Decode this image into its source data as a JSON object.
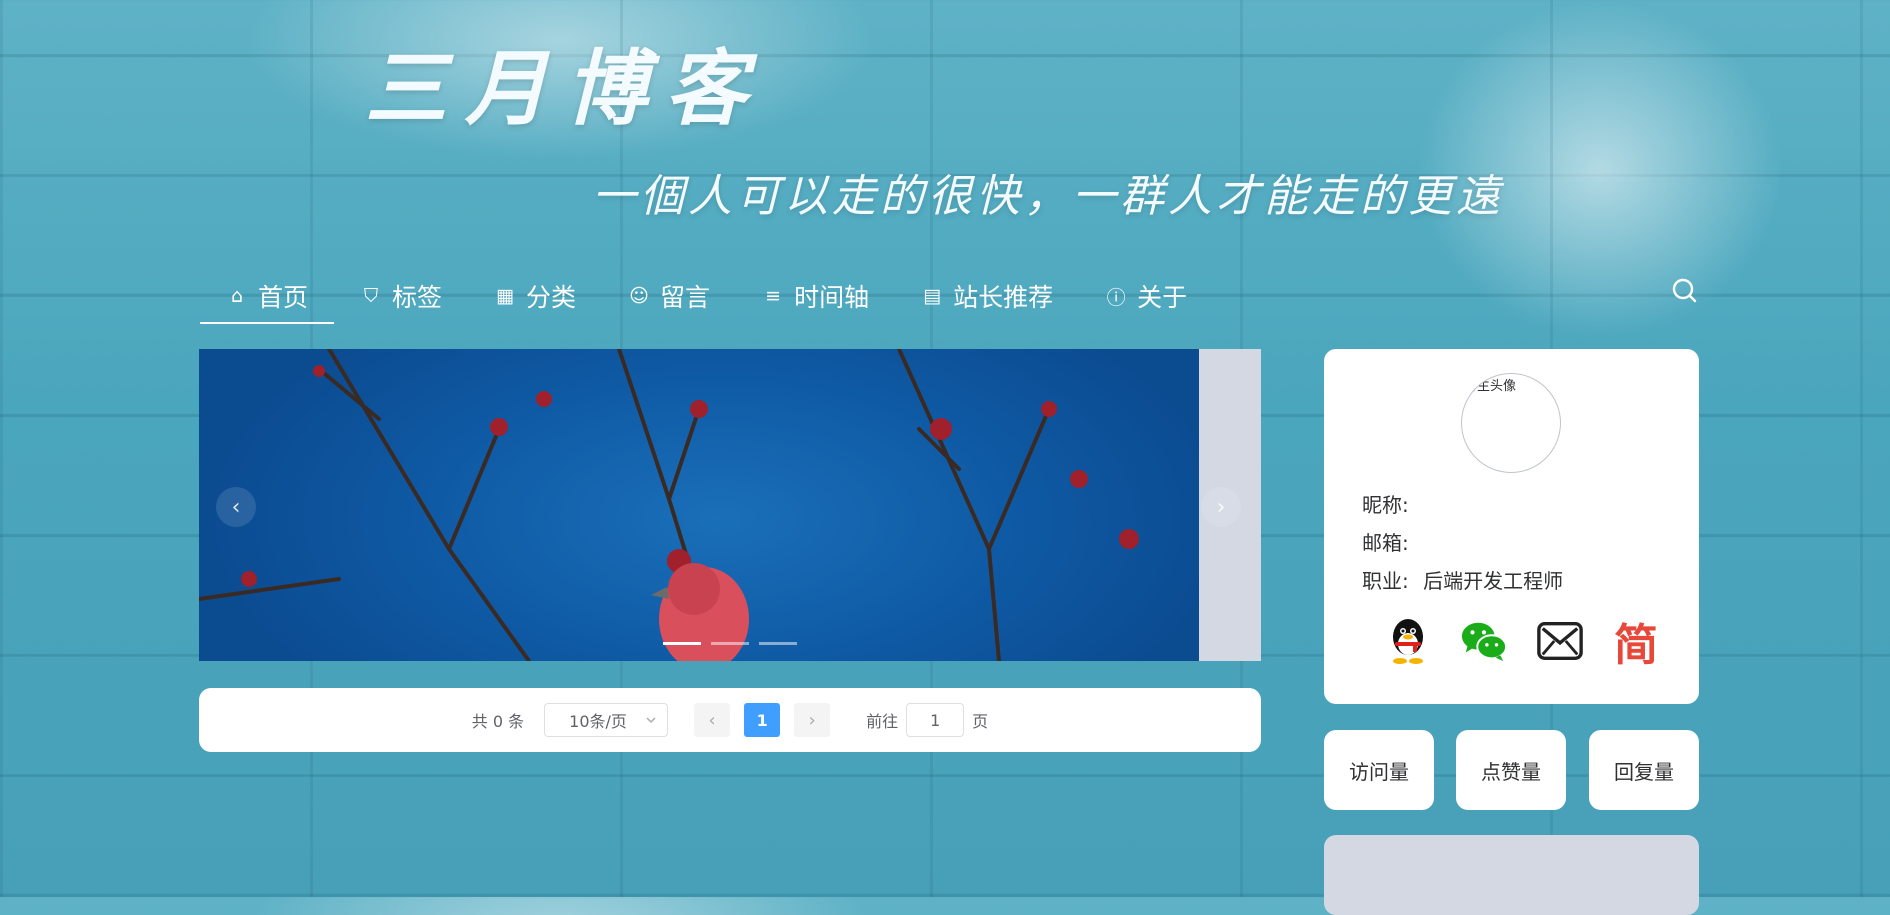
{
  "header": {
    "title": "三月博客",
    "motto": "一個人可以走的很快，一群人才能走的更遠"
  },
  "nav": {
    "items": [
      {
        "label": "首页",
        "icon": "home-icon",
        "glyph": "⌂"
      },
      {
        "label": "标签",
        "icon": "bookmark-icon",
        "glyph": "⛉"
      },
      {
        "label": "分类",
        "icon": "grid-icon",
        "glyph": "▦"
      },
      {
        "label": "留言",
        "icon": "chat-icon",
        "glyph": "☺"
      },
      {
        "label": "时间轴",
        "icon": "list-icon",
        "glyph": "≡"
      },
      {
        "label": "站长推荐",
        "icon": "document-icon",
        "glyph": "▤"
      },
      {
        "label": "关于",
        "icon": "info-icon",
        "glyph": "ⓘ"
      }
    ],
    "active_index": 0
  },
  "carousel": {
    "prev_glyph": "‹",
    "next_glyph": "›",
    "slide_count": 3,
    "active_slide": 1
  },
  "pagination": {
    "total_text": "共 0 条",
    "page_size_label": "10条/页",
    "prev_glyph": "‹",
    "next_glyph": "›",
    "current_page": "1",
    "goto_prefix": "前往",
    "goto_value": "1",
    "goto_suffix": "页"
  },
  "profile": {
    "avatar_alt": "博主头像",
    "nickname_label": "昵称:",
    "email_label": "邮箱:",
    "job_label": "职业:",
    "job_value": "后端开发工程师",
    "socials": [
      "qq-icon",
      "wechat-icon",
      "mail-icon",
      "jianshu-icon"
    ],
    "jianshu_glyph": "简"
  },
  "stats": {
    "visits": "访问量",
    "likes": "点赞量",
    "replies": "回复量"
  },
  "colors": {
    "accent": "#409eff",
    "jianshu_red": "#e8483a",
    "card_bg": "#ffffff"
  }
}
